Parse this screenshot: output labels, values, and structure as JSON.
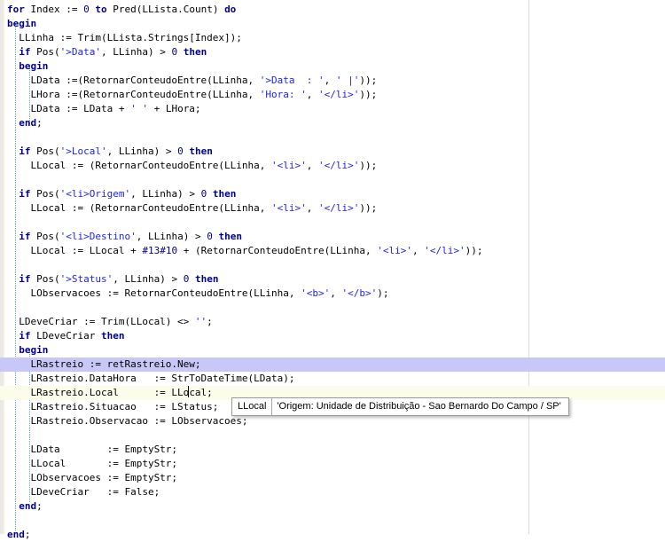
{
  "editor": {
    "lines": [
      [
        {
          "t": "for",
          "c": "kw"
        },
        {
          "t": " Index := "
        },
        {
          "t": "0",
          "c": "num"
        },
        {
          "t": " "
        },
        {
          "t": "to",
          "c": "kw"
        },
        {
          "t": " Pred(LLista.Count) "
        },
        {
          "t": "do",
          "c": "kw"
        }
      ],
      [
        {
          "t": "begin",
          "c": "kw"
        }
      ],
      [
        {
          "t": "  LLinha := Trim(LLista.Strings[Index]);"
        }
      ],
      [
        {
          "t": "  "
        },
        {
          "t": "if",
          "c": "kw"
        },
        {
          "t": " Pos("
        },
        {
          "t": "'>Data'",
          "c": "str"
        },
        {
          "t": ", LLinha) > "
        },
        {
          "t": "0",
          "c": "num"
        },
        {
          "t": " "
        },
        {
          "t": "then",
          "c": "kw"
        }
      ],
      [
        {
          "t": "  "
        },
        {
          "t": "begin",
          "c": "kw"
        }
      ],
      [
        {
          "t": "    LData :=(RetornarConteudoEntre(LLinha, "
        },
        {
          "t": "'>Data  : '",
          "c": "str"
        },
        {
          "t": ", "
        },
        {
          "t": "' |'",
          "c": "str"
        },
        {
          "t": "));"
        }
      ],
      [
        {
          "t": "    LHora :=(RetornarConteudoEntre(LLinha, "
        },
        {
          "t": "'Hora: '",
          "c": "str"
        },
        {
          "t": ", "
        },
        {
          "t": "'</li>'",
          "c": "str"
        },
        {
          "t": "));"
        }
      ],
      [
        {
          "t": "    LData := LData + "
        },
        {
          "t": "' '",
          "c": "str"
        },
        {
          "t": " + LHora;"
        }
      ],
      [
        {
          "t": "  "
        },
        {
          "t": "end",
          "c": "kw"
        },
        {
          "t": ";"
        }
      ],
      [],
      [
        {
          "t": "  "
        },
        {
          "t": "if",
          "c": "kw"
        },
        {
          "t": " Pos("
        },
        {
          "t": "'>Local'",
          "c": "str"
        },
        {
          "t": ", LLinha) > "
        },
        {
          "t": "0",
          "c": "num"
        },
        {
          "t": " "
        },
        {
          "t": "then",
          "c": "kw"
        }
      ],
      [
        {
          "t": "    LLocal := (RetornarConteudoEntre(LLinha, "
        },
        {
          "t": "'<li>'",
          "c": "str"
        },
        {
          "t": ", "
        },
        {
          "t": "'</li>'",
          "c": "str"
        },
        {
          "t": "));"
        }
      ],
      [],
      [
        {
          "t": "  "
        },
        {
          "t": "if",
          "c": "kw"
        },
        {
          "t": " Pos("
        },
        {
          "t": "'<li>Origem'",
          "c": "str"
        },
        {
          "t": ", LLinha) > "
        },
        {
          "t": "0",
          "c": "num"
        },
        {
          "t": " "
        },
        {
          "t": "then",
          "c": "kw"
        }
      ],
      [
        {
          "t": "    LLocal := (RetornarConteudoEntre(LLinha, "
        },
        {
          "t": "'<li>'",
          "c": "str"
        },
        {
          "t": ", "
        },
        {
          "t": "'</li>'",
          "c": "str"
        },
        {
          "t": "));"
        }
      ],
      [],
      [
        {
          "t": "  "
        },
        {
          "t": "if",
          "c": "kw"
        },
        {
          "t": " Pos("
        },
        {
          "t": "'<li>Destino'",
          "c": "str"
        },
        {
          "t": ", LLinha) > "
        },
        {
          "t": "0",
          "c": "num"
        },
        {
          "t": " "
        },
        {
          "t": "then",
          "c": "kw"
        }
      ],
      [
        {
          "t": "    LLocal := LLocal + "
        },
        {
          "t": "#13#10",
          "c": "num"
        },
        {
          "t": " + (RetornarConteudoEntre(LLinha, "
        },
        {
          "t": "'<li>'",
          "c": "str"
        },
        {
          "t": ", "
        },
        {
          "t": "'</li>'",
          "c": "str"
        },
        {
          "t": "));"
        }
      ],
      [],
      [
        {
          "t": "  "
        },
        {
          "t": "if",
          "c": "kw"
        },
        {
          "t": " Pos("
        },
        {
          "t": "'>Status'",
          "c": "str"
        },
        {
          "t": ", LLinha) > "
        },
        {
          "t": "0",
          "c": "num"
        },
        {
          "t": " "
        },
        {
          "t": "then",
          "c": "kw"
        }
      ],
      [
        {
          "t": "    LObservacoes := RetornarConteudoEntre(LLinha, "
        },
        {
          "t": "'<b>'",
          "c": "str"
        },
        {
          "t": ", "
        },
        {
          "t": "'</b>'",
          "c": "str"
        },
        {
          "t": ");"
        }
      ],
      [],
      [
        {
          "t": "  LDeveCriar := Trim(LLocal) <> "
        },
        {
          "t": "''",
          "c": "str"
        },
        {
          "t": ";"
        }
      ],
      [
        {
          "t": "  "
        },
        {
          "t": "if",
          "c": "kw"
        },
        {
          "t": " LDeveCriar "
        },
        {
          "t": "then",
          "c": "kw"
        }
      ],
      [
        {
          "t": "  "
        },
        {
          "t": "begin",
          "c": "kw"
        }
      ],
      [
        {
          "t": "    LRastreio := retRastreio.New;"
        }
      ],
      [
        {
          "t": "    LRastreio.DataHora   := StrToDateTime(LData);"
        }
      ],
      [
        {
          "t": "    LRastreio.Local      := LLo"
        },
        {
          "t": "",
          "c": "caret"
        },
        {
          "t": "cal;"
        }
      ],
      [
        {
          "t": "    LRastreio.Situacao   := LStatus;"
        }
      ],
      [
        {
          "t": "    LRastreio.Observacao := LObservacoes;"
        }
      ],
      [],
      [
        {
          "t": "    LData        := EmptyStr;"
        }
      ],
      [
        {
          "t": "    LLocal       := EmptyStr;"
        }
      ],
      [
        {
          "t": "    LObservacoes := EmptyStr;"
        }
      ],
      [
        {
          "t": "    LDeveCriar   := False;"
        }
      ],
      [
        {
          "t": "  "
        },
        {
          "t": "end",
          "c": "kw"
        },
        {
          "t": ";"
        }
      ],
      [],
      [
        {
          "t": "end",
          "c": "kw"
        },
        {
          "t": ";"
        }
      ]
    ]
  },
  "hint": {
    "name": "LLocal",
    "value": "'Origem: Unidade de Distribuição - Sao Bernardo Do Campo / SP'"
  }
}
